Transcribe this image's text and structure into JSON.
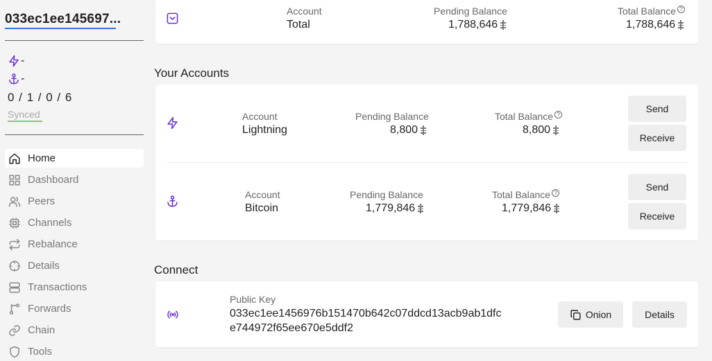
{
  "sidebar": {
    "node_alias": "033ec1ee145697...",
    "lightning_status": "-",
    "bitcoin_status": "-",
    "channel_counts": "0 / 1 / 0 / 6",
    "sync_status": "Synced",
    "items": [
      {
        "label": "Home",
        "icon": "home-icon",
        "active": true
      },
      {
        "label": "Dashboard",
        "icon": "grid-icon"
      },
      {
        "label": "Peers",
        "icon": "users-icon"
      },
      {
        "label": "Channels",
        "icon": "cpu-icon"
      },
      {
        "label": "Rebalance",
        "icon": "rebalance-icon"
      },
      {
        "label": "Details",
        "icon": "crosshair-icon"
      },
      {
        "label": "Transactions",
        "icon": "server-icon"
      },
      {
        "label": "Forwards",
        "icon": "route-icon"
      },
      {
        "label": "Chain",
        "icon": "link-icon"
      },
      {
        "label": "Tools",
        "icon": "shield-icon"
      }
    ]
  },
  "total_card": {
    "account_label": "Account",
    "account_value": "Total",
    "pending_label": "Pending Balance",
    "pending_value": "1,788,646",
    "total_label": "Total Balance",
    "total_value": "1,788,646"
  },
  "accounts": {
    "title": "Your Accounts",
    "lightning": {
      "account_label": "Account",
      "account_value": "Lightning",
      "pending_label": "Pending Balance",
      "pending_value": "8,800",
      "total_label": "Total Balance",
      "total_value": "8,800",
      "send_label": "Send",
      "receive_label": "Receive"
    },
    "bitcoin": {
      "account_label": "Account",
      "account_value": "Bitcoin",
      "pending_label": "Pending Balance",
      "pending_value": "1,779,846",
      "total_label": "Total Balance",
      "total_value": "1,779,846",
      "send_label": "Send",
      "receive_label": "Receive"
    }
  },
  "connect": {
    "title": "Connect",
    "pubkey_label": "Public Key",
    "pubkey_line1": "033ec1ee1456976b151470b642c07ddcd13acb9ab1dfc",
    "pubkey_line2": "e744972f65ee670e5ddf2",
    "onion_label": "Onion",
    "details_label": "Details"
  },
  "colors": {
    "accent": "#6b32d6",
    "synced_underline": "#7ecb6a",
    "alias_underline": "#3a6fd8"
  }
}
